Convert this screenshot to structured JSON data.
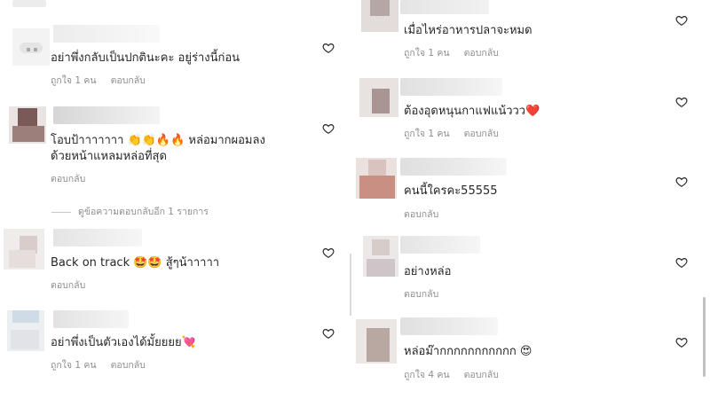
{
  "accent_colors": {
    "text": "#262626",
    "meta": "#8e8e8e",
    "heart_outline": "#262626"
  },
  "left_comments": [
    {
      "text": "อย่าพึ่งกลับเป็นปกตินะคะ  อยู่ร่างนี้ก่อน",
      "likes": "ถูกใจ 1 คน",
      "reply": "ตอบกลับ"
    },
    {
      "text_line1": "โอบป้าาาาาาา 👏👏🔥🔥 หล่อมากผอมลง",
      "text_line2": "ด้วยหน้าแหลมหล่อที่สุด",
      "reply": "ตอบกลับ",
      "view_replies": "ดูข้อความตอบกลับอีก 1 รายการ"
    },
    {
      "text": "Back on track 🤩🤩 สู้ๆน้าาาาา",
      "reply": "ตอบกลับ"
    },
    {
      "text": "อย่าพึ่งเป็นตัวเองได้มั้ยยยย💘",
      "likes": "ถูกใจ 1 คน",
      "reply": "ตอบกลับ"
    }
  ],
  "right_comments": [
    {
      "text": "เมื่อไหร่อาหารปลาจะหมด",
      "likes": "ถูกใจ 1 คน",
      "reply": "ตอบกลับ"
    },
    {
      "text": "ต้องอุดหนุนกาแฟแน้ววว❤️",
      "likes": "ถูกใจ 1 คน",
      "reply": "ตอบกลับ"
    },
    {
      "text": "คนนี้ใครคะ55555",
      "reply": "ตอบกลับ"
    },
    {
      "text": "อย่างหล่อ",
      "reply": "ตอบกลับ"
    },
    {
      "text": "หล่อม๊ากกกกกกกกกกก 😍",
      "likes": "ถูกใจ 4 คน",
      "reply": "ตอบกลับ"
    }
  ],
  "icons": {
    "like": "heart-outline-icon"
  }
}
